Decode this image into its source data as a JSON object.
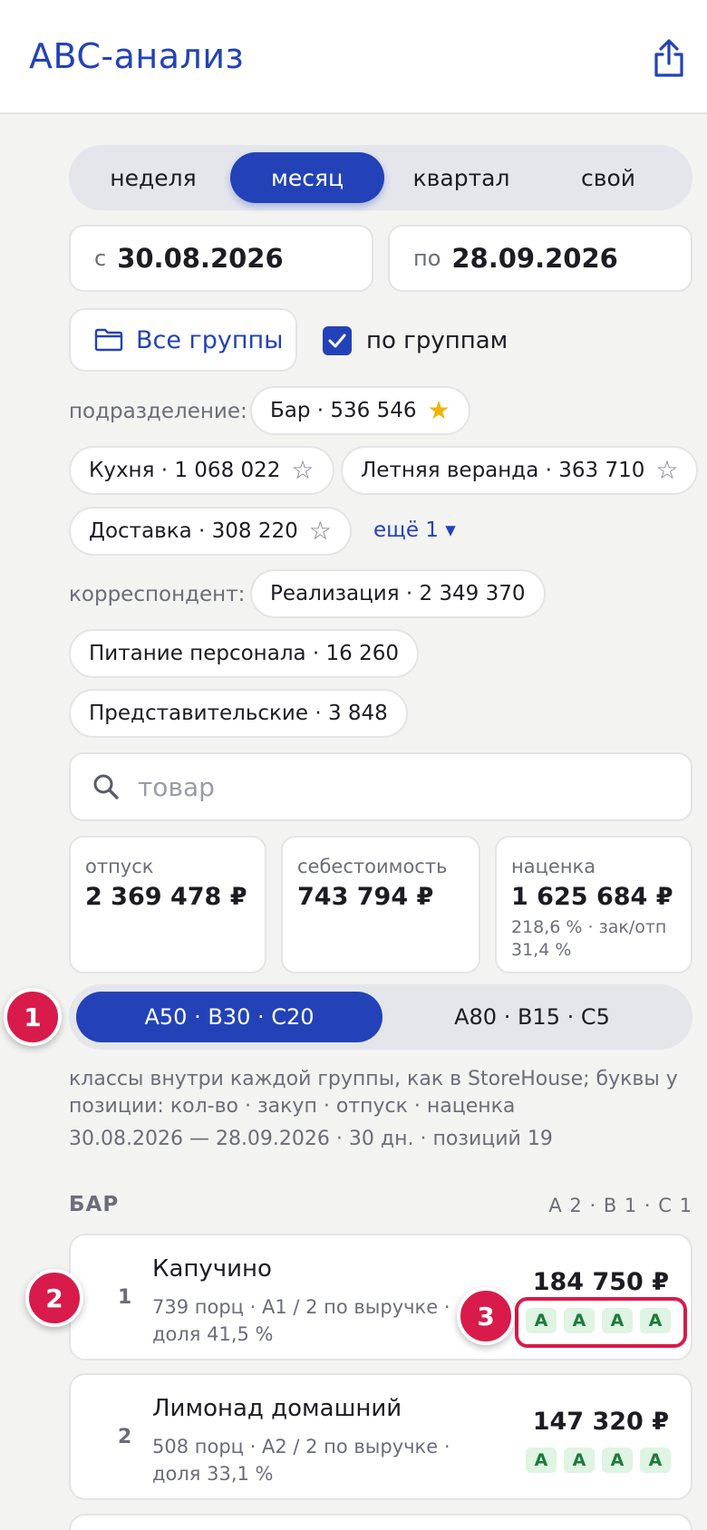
{
  "header": {
    "title": "ABC-анализ",
    "share_icon": "share-icon"
  },
  "period_tabs": [
    {
      "label": "неделя",
      "active": false
    },
    {
      "label": "месяц",
      "active": true
    },
    {
      "label": "квартал",
      "active": false
    },
    {
      "label": "свой",
      "active": false
    }
  ],
  "dates": {
    "from_prefix": "с",
    "from": "30.08.2026",
    "to_prefix": "по",
    "to": "28.09.2026"
  },
  "groups": {
    "button_label": "Все группы",
    "checkbox_label": "по группам",
    "checkbox_checked": true
  },
  "subdivision": {
    "label": "подразделение:",
    "chips": [
      {
        "label": "Бар · 536 546",
        "starred": true
      },
      {
        "label": "Кухня · 1 068 022",
        "starred": false
      },
      {
        "label": "Летняя веранда · 363 710",
        "starred": false
      },
      {
        "label": "Доставка · 308 220",
        "starred": false
      }
    ],
    "more": "ещё 1 ▾"
  },
  "correspondent": {
    "label": "корреспондент:",
    "chips": [
      {
        "label": "Реализация · 2 349 370"
      },
      {
        "label": "Питание персонала · 16 260"
      },
      {
        "label": "Представительские · 3 848"
      }
    ]
  },
  "search": {
    "placeholder": "товар",
    "value": ""
  },
  "stats": [
    {
      "label": "отпуск",
      "value": "2 369 478 ₽"
    },
    {
      "label": "себестоимость",
      "value": "743 794 ₽"
    },
    {
      "label": "наценка",
      "value": "1 625 684 ₽",
      "sub": "218,6 % · зак/отп 31,4 %"
    }
  ],
  "class_tabs": [
    {
      "label": "A50 · B30 · C20",
      "active": true
    },
    {
      "label": "A80 · B15 · C5",
      "active": false
    }
  ],
  "note": "классы внутри каждой группы, как в StoreHouse; буквы у позиции: кол-во · закуп · отпуск · наценка",
  "period_summary": "30.08.2026 — 28.09.2026 · 30 дн. · позиций 19",
  "section": {
    "title": "БАР",
    "summary": "A 2 · B 1 · C 1",
    "items": [
      {
        "rank": "1",
        "name": "Капучино",
        "meta": "739 порц · A1 / 2 по выручке · доля 41,5 %",
        "sum": "184 750 ₽",
        "letters": [
          "A",
          "A",
          "A",
          "A"
        ]
      },
      {
        "rank": "2",
        "name": "Лимонад домашний",
        "meta": "508 порц · A2 / 2 по выручке · доля 33,1 %",
        "sum": "147 320 ₽",
        "letters": [
          "A",
          "A",
          "A",
          "A"
        ]
      }
    ]
  },
  "annotations": [
    "1",
    "2",
    "3"
  ],
  "colors": {
    "accent": "#2342b8",
    "badge": "#d81b4a",
    "star": "#f0b400",
    "class_a_bg": "#dff4e3",
    "class_a_fg": "#1d7a3a"
  }
}
